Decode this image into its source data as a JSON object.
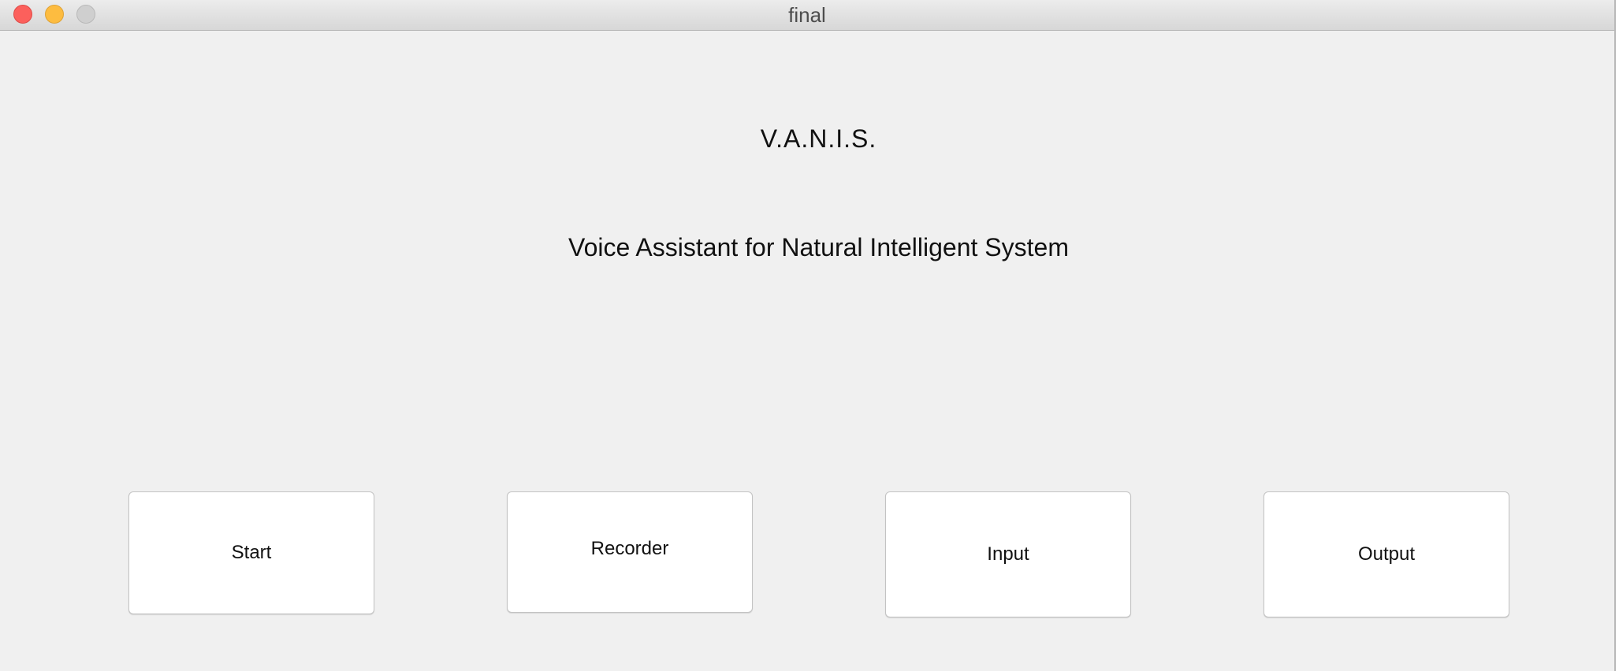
{
  "window": {
    "title": "final"
  },
  "header": {
    "acronym": "V.A.N.I.S.",
    "full_name": "Voice Assistant for Natural Intelligent System"
  },
  "buttons": {
    "start": "Start",
    "recorder": "Recorder",
    "input": "Input",
    "output": "Output"
  },
  "colors": {
    "window_background": "#f0f0f0",
    "close": "#fc605c",
    "minimize": "#fdbc40",
    "zoom_disabled": "#cfcfcf"
  }
}
